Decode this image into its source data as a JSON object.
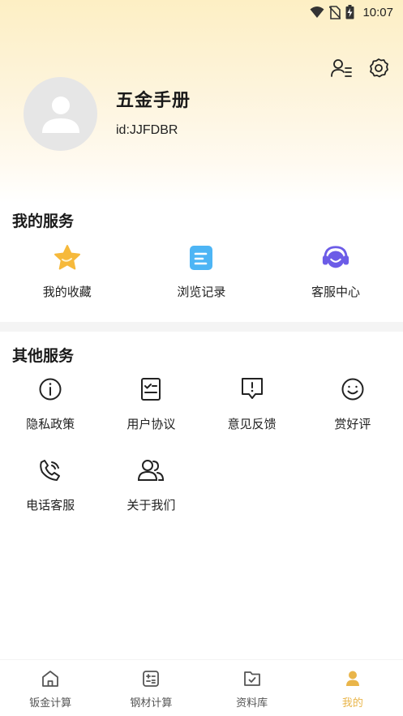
{
  "status_bar": {
    "time": "10:07"
  },
  "profile": {
    "name": "五金手册",
    "id_text": "id:JJFDBR"
  },
  "my_services": {
    "title": "我的服务",
    "items": [
      {
        "label": "我的收藏",
        "icon": "star-icon"
      },
      {
        "label": "浏览记录",
        "icon": "history-icon"
      },
      {
        "label": "客服中心",
        "icon": "headset-icon"
      }
    ]
  },
  "other_services": {
    "title": "其他服务",
    "items": [
      {
        "label": "隐私政策",
        "icon": "info-icon"
      },
      {
        "label": "用户协议",
        "icon": "checklist-icon"
      },
      {
        "label": "意见反馈",
        "icon": "feedback-icon"
      },
      {
        "label": "赏好评",
        "icon": "smile-icon"
      },
      {
        "label": "电话客服",
        "icon": "phone-icon"
      },
      {
        "label": "关于我们",
        "icon": "users-icon"
      }
    ]
  },
  "tab_bar": {
    "active": 3,
    "accent_color": "#e9b54a",
    "items": [
      {
        "label": "钣金计算",
        "icon": "home-icon"
      },
      {
        "label": "钢材计算",
        "icon": "calculator-icon"
      },
      {
        "label": "资料库",
        "icon": "folder-icon"
      },
      {
        "label": "我的",
        "icon": "person-icon"
      }
    ]
  }
}
